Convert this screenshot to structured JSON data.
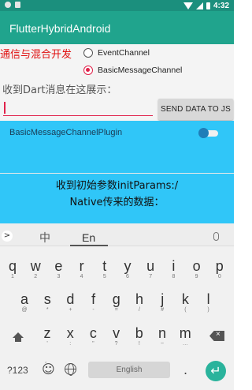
{
  "status_bar": {
    "time": "4:32"
  },
  "app_bar": {
    "title": "FlutterHybridAndroid"
  },
  "flutter": {
    "channel_title": "通信与混合开发",
    "radio_options": [
      {
        "label": "EventChannel",
        "selected": false
      },
      {
        "label": "BasicMessageChannel",
        "selected": true
      }
    ],
    "receive_label": "收到Dart消息在这展示：",
    "input_value": "",
    "send_button_label": "SEND DATA TO JS"
  },
  "native": {
    "plugin_label": "BasicMessageChannelPlugin",
    "toggle_on": false,
    "init_params_label": "收到初始参数initParams:/",
    "native_data_label": "Native传来的数据："
  },
  "keyboard": {
    "lang_zh": "中",
    "lang_en": "En",
    "row1": [
      {
        "main": "q",
        "sub": "1"
      },
      {
        "main": "w",
        "sub": "2"
      },
      {
        "main": "e",
        "sub": "3"
      },
      {
        "main": "r",
        "sub": "4"
      },
      {
        "main": "t",
        "sub": "5"
      },
      {
        "main": "y",
        "sub": "6"
      },
      {
        "main": "u",
        "sub": "7"
      },
      {
        "main": "i",
        "sub": "8"
      },
      {
        "main": "o",
        "sub": "9"
      },
      {
        "main": "p",
        "sub": "0"
      }
    ],
    "row2": [
      {
        "main": "a",
        "sub": "@"
      },
      {
        "main": "s",
        "sub": "*"
      },
      {
        "main": "d",
        "sub": "+"
      },
      {
        "main": "f",
        "sub": "-"
      },
      {
        "main": "g",
        "sub": "="
      },
      {
        "main": "h",
        "sub": "/"
      },
      {
        "main": "j",
        "sub": "#"
      },
      {
        "main": "k",
        "sub": "("
      },
      {
        "main": "l",
        "sub": ")"
      }
    ],
    "row3": [
      {
        "main": "z",
        "sub": "'"
      },
      {
        "main": "x",
        "sub": ":"
      },
      {
        "main": "c",
        "sub": "\""
      },
      {
        "main": "v",
        "sub": "?"
      },
      {
        "main": "b",
        "sub": "!"
      },
      {
        "main": "n",
        "sub": "~"
      },
      {
        "main": "m",
        "sub": "…"
      }
    ],
    "numbers_label": "?123",
    "emoji_label": "☺",
    "comma_sup": ",",
    "space_label": "English",
    "period_label": ".",
    "enter_label": "↵"
  },
  "colors": {
    "app_bar": "#20a48d",
    "accent": "#e0224a",
    "native_bg": "#30c6f8",
    "enter_key": "#2ab39c"
  }
}
